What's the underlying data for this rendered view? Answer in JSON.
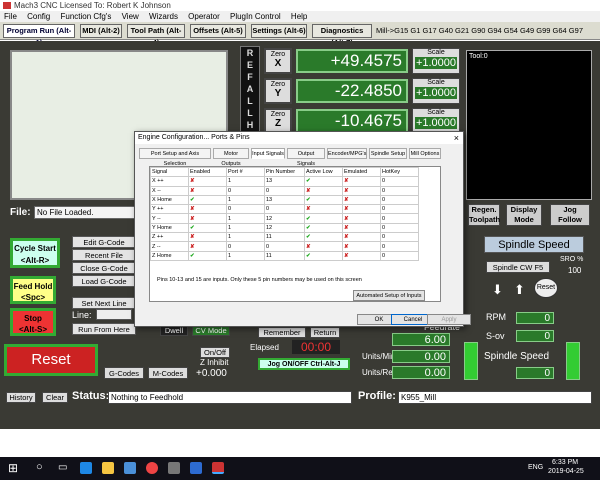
{
  "window": {
    "title": "Mach3 CNC  Licensed To:   Robert K Johnson"
  },
  "menu": [
    "File",
    "Config",
    "Function Cfg's",
    "View",
    "Wizards",
    "Operator",
    "PlugIn Control",
    "Help"
  ],
  "tabs": [
    "Program Run (Alt-1)",
    "MDI (Alt-2)",
    "Tool Path (Alt-4)",
    "Offsets (Alt-5)",
    "Settings (Alt-6)",
    "Diagnostics (Alt-7)"
  ],
  "gcodes_line": "Mill->G15  G1 G17 G40 G21 G90 G94 G54 G49 G99 G64 G97",
  "ref_all_home": "REFALLHO",
  "axes": [
    {
      "zero_label": "Zero",
      "axis": "X",
      "value": "+49.4575",
      "scale_label": "Scale",
      "scale": "+1.0000"
    },
    {
      "zero_label": "Zero",
      "axis": "Y",
      "value": "-22.4850",
      "scale_label": "Scale",
      "scale": "+1.0000"
    },
    {
      "zero_label": "Zero",
      "axis": "Z",
      "value": "-10.4675",
      "scale_label": "Scale",
      "scale": "+1.0000"
    }
  ],
  "tool_label": "Tool:0",
  "file": {
    "label": "File:",
    "value": "No File Loaded."
  },
  "left_buttons": {
    "cycle_start": "Cycle Start\n<Alt-R>",
    "feed_hold": "Feed Hold\n<Spc>",
    "stop": "Stop\n<Alt-S>",
    "reset": "Reset"
  },
  "gcode_buttons": [
    "Edit G-Code",
    "Recent File",
    "Close G-Code",
    "Load G-Code",
    "Set Next Line",
    "Run From Here"
  ],
  "line_label": "Line:",
  "dwell": "Dwell",
  "cv_mode": "CV Mode",
  "on_off": "On/Off",
  "z_inhibit": {
    "label": "Z Inhibit",
    "value": "+0.000"
  },
  "gcodes_btn": "G-Codes",
  "mcodes_btn": "M-Codes",
  "remember": "Remember",
  "return": "Return",
  "elapsed": {
    "label": "Elapsed",
    "value": "00:00"
  },
  "jog_onoff": "Jog ON/OFF Ctrl-Alt-J",
  "feedrate": {
    "label": "Feedrate",
    "value": "6.00"
  },
  "units_min": {
    "label": "Units/Min",
    "value": "0.00"
  },
  "units_rev": {
    "label": "Units/Rev",
    "value": "0.00"
  },
  "right_panel": {
    "regen": "Regen. Toolpath",
    "display_mode": "Display Mode",
    "jog_follow": "Jog Follow",
    "spindle_speed_title": "Spindle Speed",
    "spindle_cw": "Spindle CW F5",
    "sro_label": "SRO %",
    "sro_value": "100",
    "reset_small": "Reset",
    "rpm_label": "RPM",
    "rpm_value": "0",
    "sov_label": "S-ov",
    "sov_value": "0",
    "spindle_speed_label": "Spindle Speed",
    "spindle_speed_value": "0"
  },
  "status": {
    "history": "History",
    "clear": "Clear",
    "label": "Status:",
    "value": "Nothing to Feedhold",
    "profile_label": "Profile:",
    "profile_value": "K955_Mill"
  },
  "dialog": {
    "title": "Engine Configuration... Ports & Pins",
    "close": "×",
    "tabs": [
      "Port Setup and Axis Selection",
      "Motor Outputs",
      "Input Signals",
      "Output Signals",
      "Encoder/MPG's",
      "Spindle Setup",
      "Mill Options"
    ],
    "columns": [
      "Signal",
      "Enabled",
      "Port #",
      "Pin Number",
      "Active Low",
      "Emulated",
      "HotKey"
    ],
    "rows": [
      {
        "signal": "X ++",
        "enabled": false,
        "port": "1",
        "pin": "13",
        "active_low": true,
        "emulated": false,
        "hotkey": "0"
      },
      {
        "signal": "X --",
        "enabled": false,
        "port": "0",
        "pin": "0",
        "active_low": false,
        "emulated": false,
        "hotkey": "0"
      },
      {
        "signal": "X Home",
        "enabled": true,
        "port": "1",
        "pin": "13",
        "active_low": true,
        "emulated": false,
        "hotkey": "0"
      },
      {
        "signal": "Y ++",
        "enabled": false,
        "port": "0",
        "pin": "0",
        "active_low": false,
        "emulated": false,
        "hotkey": "0"
      },
      {
        "signal": "Y --",
        "enabled": false,
        "port": "1",
        "pin": "12",
        "active_low": true,
        "emulated": false,
        "hotkey": "0"
      },
      {
        "signal": "Y Home",
        "enabled": true,
        "port": "1",
        "pin": "12",
        "active_low": true,
        "emulated": false,
        "hotkey": "0"
      },
      {
        "signal": "Z ++",
        "enabled": false,
        "port": "1",
        "pin": "11",
        "active_low": true,
        "emulated": false,
        "hotkey": "0"
      },
      {
        "signal": "Z --",
        "enabled": false,
        "port": "0",
        "pin": "0",
        "active_low": false,
        "emulated": false,
        "hotkey": "0"
      },
      {
        "signal": "Z Home",
        "enabled": true,
        "port": "1",
        "pin": "11",
        "active_low": true,
        "emulated": false,
        "hotkey": "0"
      }
    ],
    "note": "Pins 10-13 and 15 are inputs. Only these 5 pin numbers may be used on this screen",
    "auto_setup": "Automated Setup of Inputs",
    "ok": "OK",
    "cancel": "Cancel",
    "apply": "Apply"
  },
  "taskbar": {
    "time": "6:33 PM",
    "date": "2019-04-25",
    "lang": "ENG"
  },
  "colors": {
    "dro_green": "#2a7a2a",
    "reset_red": "#cc2222",
    "background": "#3a3a34"
  }
}
